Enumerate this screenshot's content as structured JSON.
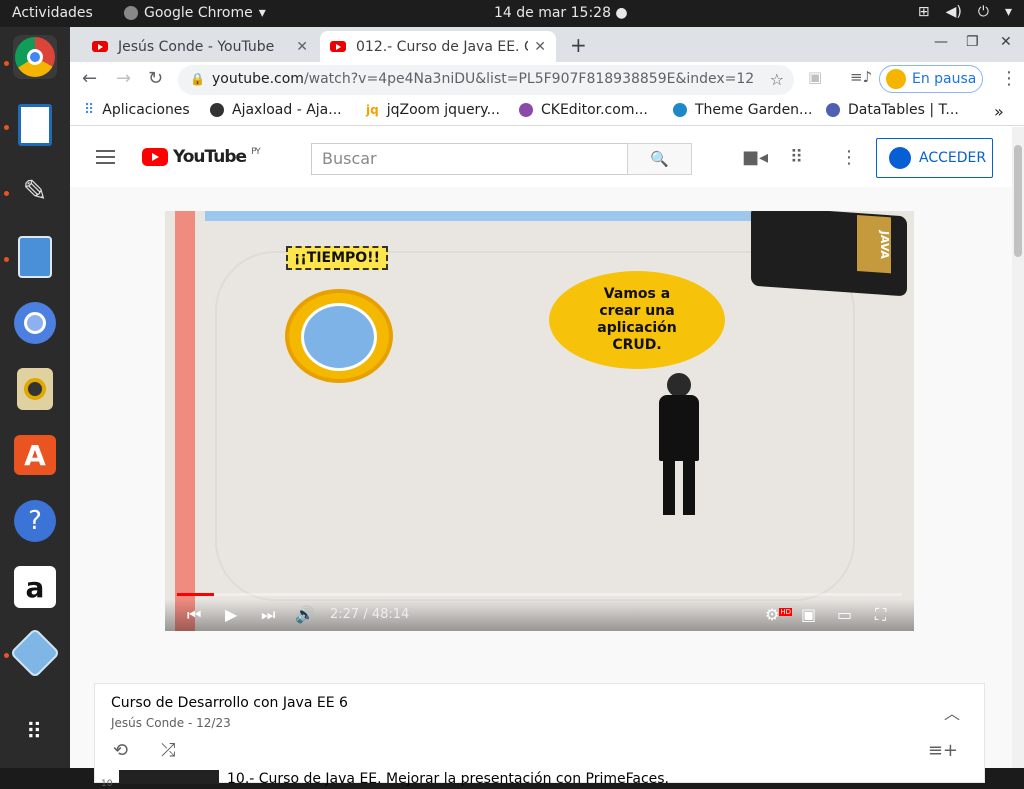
{
  "topbar": {
    "activities": "Actividades",
    "app_name": "Google Chrome",
    "app_menu_icon": "chevron-down-icon",
    "clock": "14 de mar  15:28",
    "tray_icons": [
      "network-icon",
      "volume-icon",
      "power-icon",
      "chevron-down-icon"
    ]
  },
  "dock": {
    "items": [
      {
        "name": "Google Chrome",
        "icon": "chrome-icon",
        "color": "#db4437"
      },
      {
        "name": "LibreOffice Impress",
        "icon": "presentation-icon",
        "color": "#1e6bb8"
      },
      {
        "name": "Pinta",
        "icon": "paintbrush-icon",
        "color": "#444444"
      },
      {
        "name": "Files",
        "icon": "file-cabinet-icon",
        "color": "#4a90d9"
      },
      {
        "name": "Chromium",
        "icon": "chromium-icon",
        "color": "#4b7fe0"
      },
      {
        "name": "Rhythmbox",
        "icon": "speaker-icon",
        "color": "#e0c060"
      },
      {
        "name": "Ubuntu Software",
        "icon": "software-bag-icon",
        "color": "#e95420"
      },
      {
        "name": "Help",
        "icon": "help-icon",
        "color": "#3b73d6"
      },
      {
        "name": "Amazon",
        "icon": "amazon-icon",
        "color": "#ffffff"
      },
      {
        "name": "VirtualBox",
        "icon": "cube-icon",
        "color": "#7fb6e6"
      },
      {
        "name": "Show Applications",
        "icon": "grid-icon",
        "color": "#2b2b2b"
      }
    ]
  },
  "tabs": [
    {
      "title": "Jesús Conde - YouTube",
      "active": false
    },
    {
      "title": "012.- Curso de Java EE. Cr",
      "active": true
    }
  ],
  "toolbar": {
    "url_host": "youtube.com",
    "url_path": "/watch?v=4pe4Na3niDU&list=PL5F907F818938859E&index=12",
    "profile_label": "En pausa"
  },
  "bookmarks": [
    {
      "label": "Aplicaciones",
      "color": "#4285f4"
    },
    {
      "label": "Ajaxload - Aja...",
      "color": "#333333"
    },
    {
      "label": "jqZoom jquery...",
      "color": "#f4a400"
    },
    {
      "label": "CKEditor.com...",
      "color": "#8c4aa8"
    },
    {
      "label": "Theme Garden...",
      "color": "#1e88c8"
    },
    {
      "label": "DataTables | T...",
      "color": "#5060b0"
    }
  ],
  "youtube": {
    "logo_text": "YouTube",
    "country_code": "PY",
    "search_placeholder": "Buscar",
    "login_label": "ACCEDER",
    "accent": "#065fd4"
  },
  "video": {
    "tiempo_label": "¡¡TIEMPO!!",
    "bubble_text": "Vamos a\ncrear una\naplicación\nCRUD.",
    "badge_text": "JAVA",
    "time_display": "2:27 / 48:14",
    "progress_fraction": 0.051,
    "hd_badge": "HD"
  },
  "playlist": {
    "title": "Curso de Desarrollo con Java EE 6",
    "subtitle": "Jesús Conde - 12/23",
    "item_title": "10.- Curso de Java EE. Mejorar la presentación con PrimeFaces.",
    "item_number": "10"
  }
}
